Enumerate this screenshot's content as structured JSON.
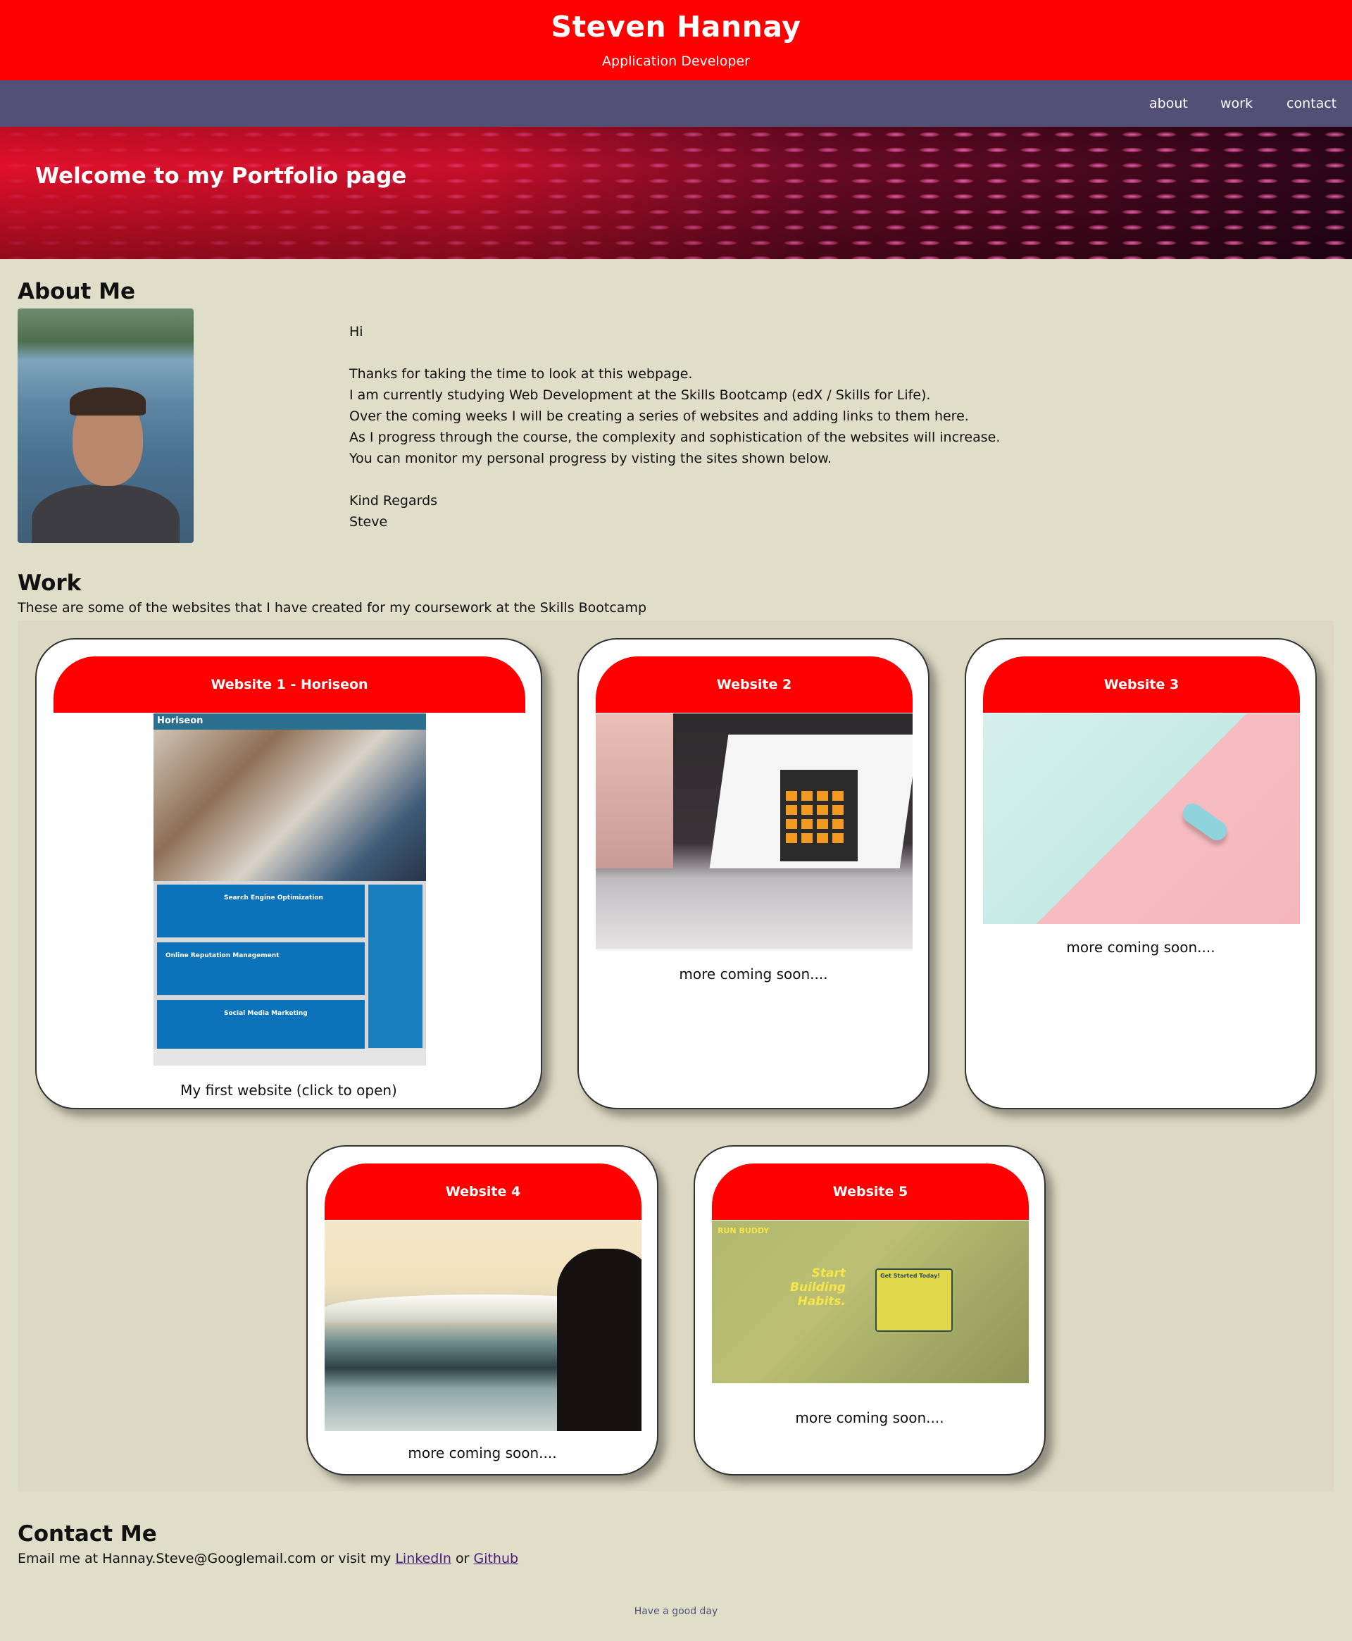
{
  "header": {
    "title": "Steven Hannay",
    "subtitle": "Application Developer"
  },
  "nav": {
    "items": [
      "about",
      "work",
      "contact"
    ]
  },
  "hero": {
    "heading": "Welcome to my Portfolio page"
  },
  "about": {
    "title": "About Me",
    "lines": [
      "Hi",
      "",
      "Thanks for taking the time to look at this webpage.",
      "I am currently studying Web Development at the Skills Bootcamp (edX / Skills for Life).",
      "Over the coming weeks I will be creating a series of websites and adding links to them here.",
      "As I progress through the course, the complexity and sophistication of the websites will increase.",
      "You can monitor my personal progress by visting the sites shown below.",
      "",
      "Kind Regards",
      "Steve"
    ]
  },
  "work": {
    "title": "Work",
    "intro": "These are some of the websites that I have created for my coursework at the Skills Bootcamp",
    "cards": [
      {
        "title": "Website 1 - Horiseon",
        "caption": "My first website (click to open)",
        "thumb_text": {
          "logo": "Horiseon",
          "seo": "Search Engine Optimization",
          "orm": "Online Reputation Management",
          "smm": "Social Media Marketing"
        }
      },
      {
        "title": "Website 2",
        "caption": "more coming soon...."
      },
      {
        "title": "Website 3",
        "caption": "more coming soon...."
      },
      {
        "title": "Website 4",
        "caption": "more coming soon...."
      },
      {
        "title": "Website 5",
        "caption": "more coming soon....",
        "thumb_text": {
          "logo": "RUN BUDDY",
          "headline": "Start Building Habits.",
          "form_title": "Get Started Today!"
        }
      }
    ]
  },
  "contact": {
    "title": "Contact Me",
    "prefix": "Email me at Hannay.Steve@Googlemail.com or visit my ",
    "linkedin": "LinkedIn",
    "middle": " or ",
    "github": "Github"
  },
  "footer": {
    "text": "Have a good day"
  },
  "colors": {
    "header_red": "#ff0000",
    "nav_purple": "#535077",
    "page_bg": "#dfdec9",
    "link_purple": "#4b1b7f"
  }
}
